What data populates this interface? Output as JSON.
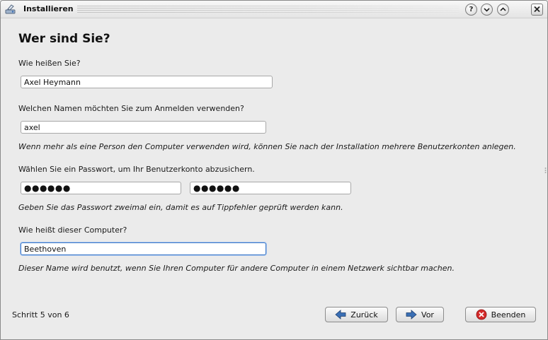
{
  "window": {
    "title": "Installieren"
  },
  "titlebar": {
    "help_glyph": "?",
    "minimize_glyph": "⌄",
    "maximize_glyph": "⌃",
    "close_glyph": "✕"
  },
  "page": {
    "heading": "Wer sind Sie?"
  },
  "form": {
    "name_label": "Wie heißen Sie?",
    "name_value": "Axel Heymann",
    "login_label": "Welchen Namen möchten Sie zum Anmelden verwenden?",
    "login_value": "axel",
    "login_hint": "Wenn mehr als eine Person den Computer verwenden wird, können Sie nach der Installation mehrere Benutzerkonten anlegen.",
    "password_label": "Wählen Sie ein Passwort, um Ihr Benutzerkonto abzusichern.",
    "password_value": "●●●●●●",
    "password_confirm_value": "●●●●●●",
    "password_hint": "Geben Sie das Passwort zweimal ein, damit es auf Tippfehler geprüft werden kann.",
    "computer_label": "Wie heißt dieser Computer?",
    "computer_value": "Beethoven",
    "computer_hint": "Dieser Name wird benutzt, wenn Sie Ihren Computer für andere Computer in einem Netzwerk sichtbar machen."
  },
  "footer": {
    "step_text": "Schritt 5 von 6",
    "back_label": "Zurück",
    "forward_label": "Vor",
    "quit_label": "Beenden"
  },
  "colors": {
    "accent_focus": "#3c78c8",
    "arrow_blue": "#3a6fb5",
    "quit_red": "#d42a2a"
  },
  "icons": [
    "app-installer-icon",
    "help-icon",
    "minimize-icon",
    "maximize-icon",
    "close-icon",
    "arrow-left-icon",
    "arrow-right-icon",
    "stop-icon"
  ]
}
